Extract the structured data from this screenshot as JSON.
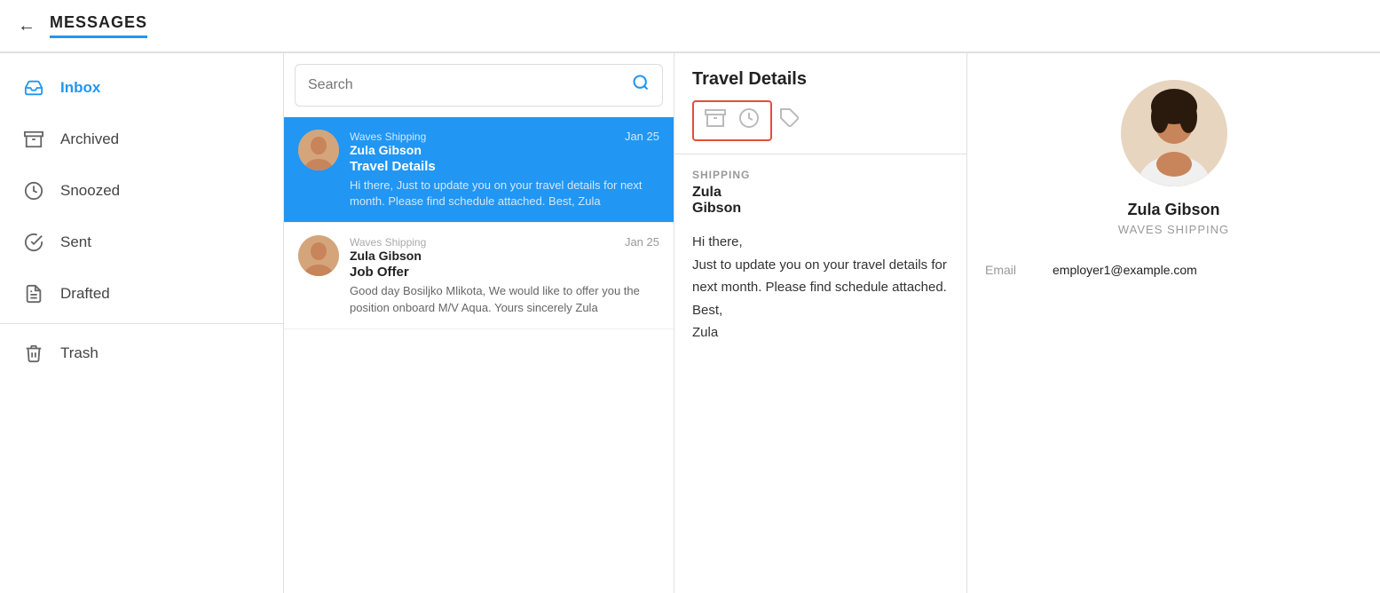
{
  "header": {
    "back_icon": "←",
    "title": "MESSAGES"
  },
  "sidebar": {
    "items": [
      {
        "id": "inbox",
        "label": "Inbox",
        "icon": "inbox",
        "active": true
      },
      {
        "id": "archived",
        "label": "Archived",
        "icon": "archive",
        "active": false
      },
      {
        "id": "snoozed",
        "label": "Snoozed",
        "icon": "clock",
        "active": false
      },
      {
        "id": "sent",
        "label": "Sent",
        "icon": "check-circle",
        "active": false
      },
      {
        "id": "drafted",
        "label": "Drafted",
        "icon": "file",
        "active": false
      },
      {
        "id": "trash",
        "label": "Trash",
        "icon": "trash",
        "active": false
      }
    ]
  },
  "search": {
    "placeholder": "Search",
    "icon": "🔍"
  },
  "messages": [
    {
      "id": "msg1",
      "company": "Waves Shipping",
      "sender": "Zula Gibson",
      "date": "Jan 25",
      "subject": "Travel Details",
      "preview": "Hi there, Just to update you on your travel details for next month. Please find schedule attached. Best, Zula",
      "active": true
    },
    {
      "id": "msg2",
      "company": "Waves Shipping",
      "sender": "Zula Gibson",
      "date": "Jan 25",
      "subject": "Job Offer",
      "preview": "Good day Bosiljko Mlikota, We would like to offer you the position onboard M/V Aqua. Yours sincerely Zula",
      "active": false
    }
  ],
  "detail": {
    "title": "Travel Details",
    "actions": {
      "archive_icon": "▤",
      "clock_icon": "◷",
      "tag_icon": "⬡"
    },
    "from_label": "SHIPPING",
    "from_name": "Zula\nGibson",
    "body": "Hi there,\nJust to update you on your travel details for next month. Please find schedule attached.\nBest,\nZula"
  },
  "contact": {
    "name": "Zula Gibson",
    "company": "WAVES SHIPPING",
    "email_label": "Email",
    "email_value": "employer1@example.com"
  }
}
